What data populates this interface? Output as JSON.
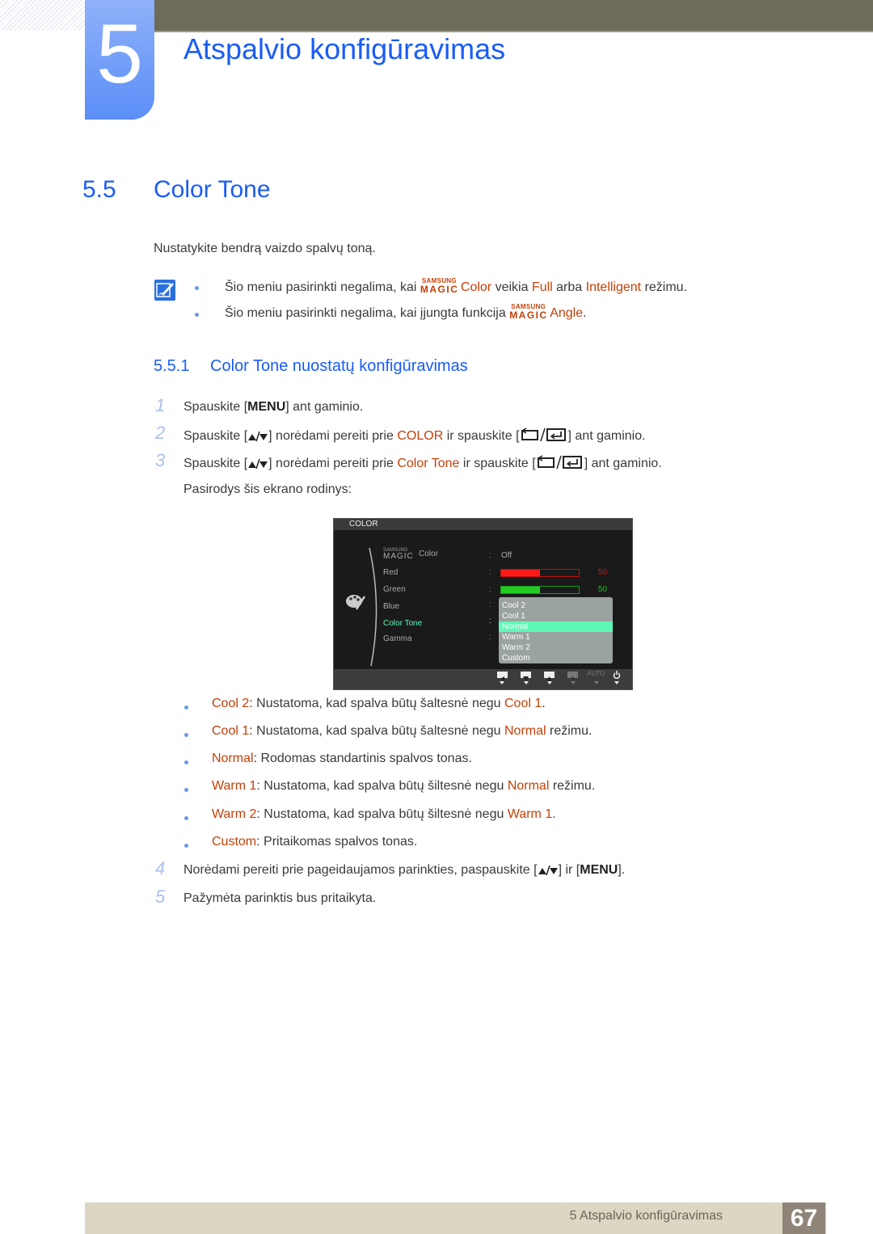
{
  "chapter": {
    "number": "5",
    "title": "Atspalvio konfigūravimas"
  },
  "section": {
    "number": "5.5",
    "title": "Color Tone",
    "intro": "Nustatykite bendrą vaizdo spalvų toną."
  },
  "notes": [
    {
      "pre": "Šio meniu pasirinkti negalima, kai ",
      "magic_top": "SAMSUNG",
      "magic_bottom": "MAGIC",
      "magic_word": "Color",
      "mid": " veikia ",
      "hl1": "Full",
      "mid2": " arba ",
      "hl2": "Intelligent",
      "post": " režimu."
    },
    {
      "pre": "Šio meniu pasirinkti negalima, kai įjungta funkcija ",
      "magic_top": "SAMSUNG",
      "magic_bottom": "MAGIC",
      "magic_word": "Angle",
      "post": "."
    }
  ],
  "subsection": {
    "number": "5.5.1",
    "title": "Color Tone nuostatų konfigūravimas"
  },
  "steps": [
    {
      "num": "1",
      "a": "Spauskite [",
      "key": "MENU",
      "b": "] ant gaminio."
    },
    {
      "num": "2",
      "a": "Spauskite [",
      "b": "] norėdami pereiti prie ",
      "hl": "COLOR",
      "c": " ir spauskite [",
      "d": "] ant gaminio."
    },
    {
      "num": "3",
      "a": "Spauskite [",
      "b": "] norėdami pereiti prie ",
      "hl": "Color Tone",
      "c": " ir spauskite [",
      "d": "] ant gaminio.",
      "e": "Pasirodys šis ekrano rodinys:"
    },
    {
      "num": "4",
      "a": "Norėdami pereiti prie pageidaujamos parinkties, paspauskite [",
      "b": "] ir [",
      "key": "MENU",
      "c": "]."
    },
    {
      "num": "5",
      "a": "Pažymėta parinktis bus pritaikyta."
    }
  ],
  "osd": {
    "header": "COLOR",
    "magic_top": "SAMSUNG",
    "magic_bottom": "MAGIC",
    "items": [
      "Color",
      "Red",
      "Green",
      "Blue",
      "Color Tone",
      "Gamma"
    ],
    "magic_color_value": "Off",
    "red": {
      "value": 50,
      "max": 100,
      "label": "50",
      "color": "#ff1a1a"
    },
    "green": {
      "value": 50,
      "max": 100,
      "label": "50",
      "color": "#22cc22"
    },
    "active_item": "Color Tone",
    "active_color": "#5ff8b8",
    "tone_options": [
      "Cool 2",
      "Cool 1",
      "Normal",
      "Warm 1",
      "Warm 2",
      "Custom"
    ],
    "selected_tone": "Normal",
    "footer_auto": "AUTO"
  },
  "tones": [
    {
      "name": "Cool 2",
      "a": ": Nustatoma, kad spalva būtų šaltesnė negu ",
      "ref": "Cool 1",
      "b": "."
    },
    {
      "name": "Cool 1",
      "a": ": Nustatoma, kad spalva būtų šaltesnė negu ",
      "ref": "Normal",
      "b": " režimu."
    },
    {
      "name": "Normal",
      "a": ": Rodomas standartinis spalvos tonas.",
      "ref": "",
      "b": ""
    },
    {
      "name": "Warm 1",
      "a": ": Nustatoma, kad spalva būtų šiltesnė negu ",
      "ref": "Normal",
      "b": " režimu."
    },
    {
      "name": "Warm 2",
      "a": ": Nustatoma, kad spalva būtų šiltesnė negu ",
      "ref": "Warm 1",
      "b": "."
    },
    {
      "name": "Custom",
      "a": ": Pritaikomas spalvos tonas.",
      "ref": "",
      "b": ""
    }
  ],
  "footer": {
    "text": "5 Atspalvio konfigūravimas",
    "page": "67"
  }
}
